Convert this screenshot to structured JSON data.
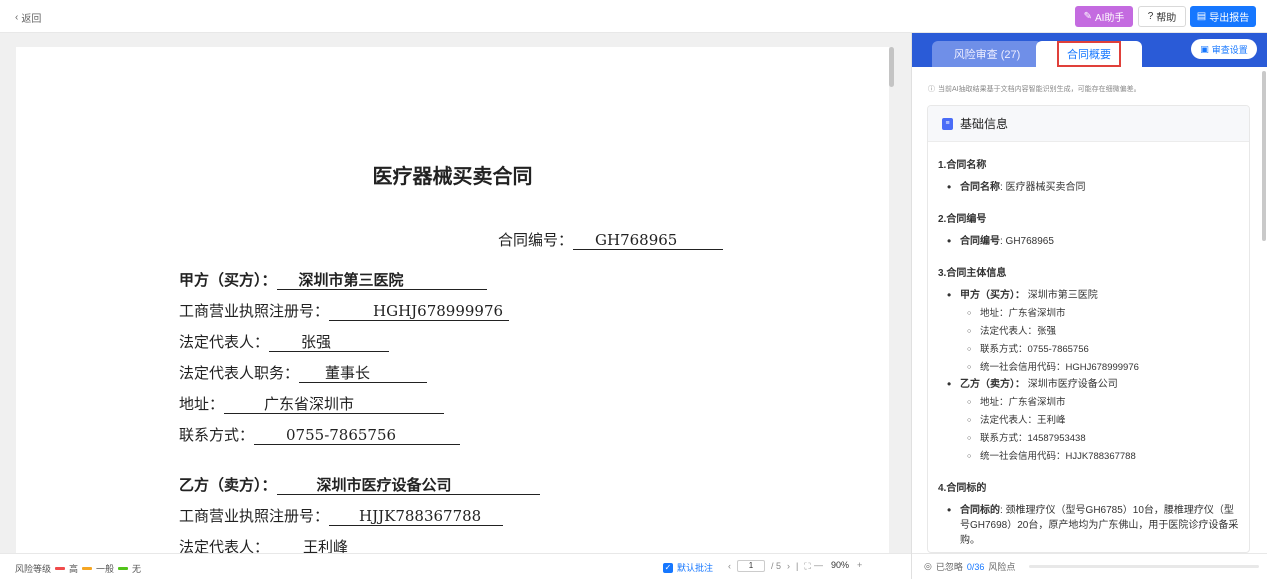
{
  "topbar": {
    "back_label": "返回",
    "ai_label": "AI助手",
    "help_label": "帮助",
    "export_label": "导出报告"
  },
  "document": {
    "title": "医疗器械买卖合同",
    "contract_no_label": "合同编号：",
    "contract_no": "GH768965",
    "party_a_label": "甲方（买方）：",
    "party_a": "深圳市第三医院",
    "a_reg_label": "工商营业执照注册号：",
    "a_reg": "HGHJ678999976",
    "a_rep_label": "法定代表人：",
    "a_rep": "张强",
    "a_rep_title_label": "法定代表人职务：",
    "a_rep_title": "董事长",
    "a_addr_label": "地址：",
    "a_addr": "广东省深圳市",
    "a_phone_label": "联系方式：",
    "a_phone": "0755-7865756",
    "party_b_label": "乙方（卖方）：",
    "party_b": "深圳市医疗设备公司",
    "b_reg_label": "工商营业执照注册号：",
    "b_reg": "HJJK788367788",
    "b_rep_label": "法定代表人：",
    "b_rep": "王利峰"
  },
  "bottombar": {
    "risk_level_label": "风险等级",
    "risk_high": "高",
    "risk_mid": "一般",
    "risk_none": "无",
    "default_annot_label": "默认批注",
    "page_current": "1",
    "page_total": "/ 5",
    "zoom": "90%",
    "colors": {
      "high": "#f04b4b",
      "mid": "#f5a623",
      "none": "#52c41a"
    }
  },
  "panel": {
    "tab_risk": "风险审查 (27)",
    "tab_summary": "合同概要",
    "settings_label": "审查设置",
    "notice": "当前AI抽取结果基于文档内容智能识别生成，可能存在细微偏差。",
    "card_title": "基础信息",
    "sec1": "1.合同名称",
    "name_label": "合同名称",
    "name_value": ": 医疗器械买卖合同",
    "sec2": "2.合同编号",
    "no_label": "合同编号",
    "no_value": ": GH768965",
    "sec3": "3.合同主体信息",
    "pa_label": "甲方（买方）：",
    "pa_value": " 深圳市第三医院",
    "pa_addr": "地址：广东省深圳市",
    "pa_rep": "法定代表人：张强",
    "pa_phone": "联系方式：0755-7865756",
    "pa_code": "统一社会信用代码：HGHJ678999976",
    "pb_label": "乙方（卖方）：",
    "pb_value": " 深圳市医疗设备公司",
    "pb_addr": "地址：广东省深圳市",
    "pb_rep": "法定代表人：王利峰",
    "pb_phone": "联系方式：14587953438",
    "pb_code": "统一社会信用代码：HJJK788367788",
    "sec4": "4.合同标的",
    "subject_label": "合同标的",
    "subject_value": ": 颈椎理疗仪（型号GH6785）10台，腰椎理疗仪（型号GH7698）20台，原产地均为广东佛山，用于医院诊疗设备采购。",
    "footer_label": "已忽略",
    "footer_count": "0/36",
    "footer_suffix": "风险点"
  }
}
